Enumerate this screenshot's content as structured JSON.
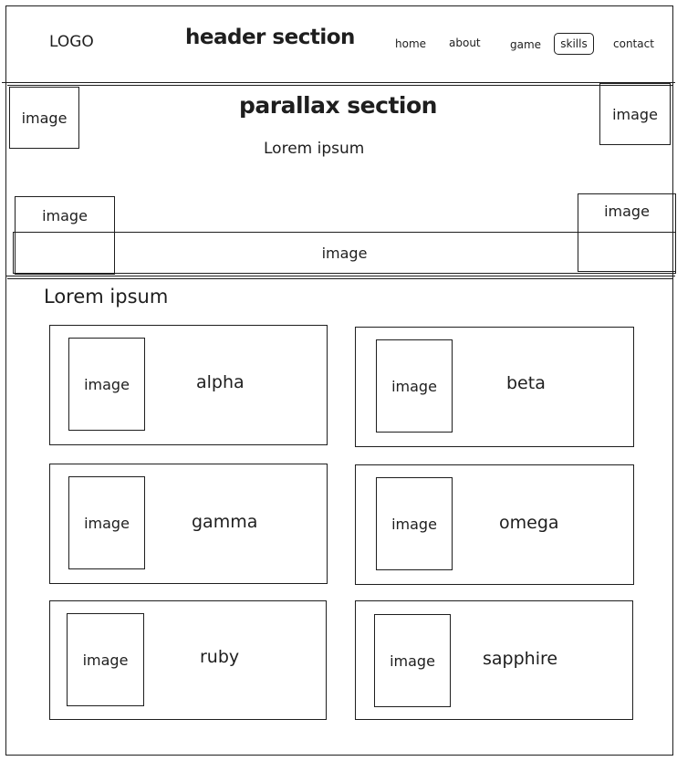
{
  "header": {
    "logo": "LOGO",
    "title": "header section",
    "nav": [
      "home",
      "about",
      "game",
      "skills",
      "contact"
    ]
  },
  "parallax": {
    "title": "parallax section",
    "subtitle": "Lorem ipsum",
    "image_label": "image"
  },
  "content": {
    "heading": "Lorem ipsum",
    "image_label": "image",
    "cards": [
      "alpha",
      "beta",
      "gamma",
      "omega",
      "ruby",
      "sapphire"
    ]
  }
}
